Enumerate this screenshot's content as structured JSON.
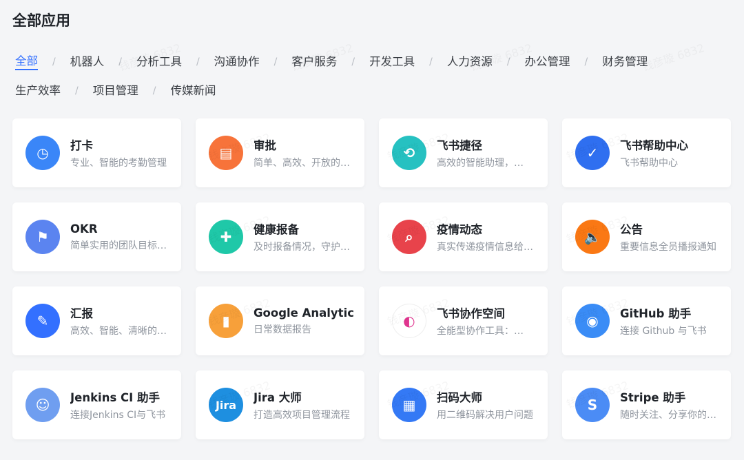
{
  "page_title": "全部应用",
  "watermark": "钱彦璇 6832",
  "tabs": [
    "全部",
    "机器人",
    "分析工具",
    "沟通协作",
    "客户服务",
    "开发工具",
    "人力资源",
    "办公管理",
    "财务管理",
    "生产效率",
    "项目管理",
    "传媒新闻"
  ],
  "separator": "/",
  "apps": [
    {
      "name": "打卡",
      "desc": "专业、智能的考勤管理",
      "icon": "location-clock-icon",
      "color": "#3a86f8",
      "glyph": "◷"
    },
    {
      "name": "审批",
      "desc": "简单、高效、开放的审批",
      "icon": "approval-stamp-icon",
      "color": "#f7733a",
      "glyph": "▤"
    },
    {
      "name": "飞书捷径",
      "desc": "高效的智能助理，…",
      "icon": "shortcut-path-icon",
      "color": "#26c1c1",
      "glyph": "⟲"
    },
    {
      "name": "飞书帮助中心",
      "desc": "飞书帮助中心",
      "icon": "help-check-icon",
      "color": "#2f6ff0",
      "glyph": "✓"
    },
    {
      "name": "OKR",
      "desc": "简单实用的团队目标管理",
      "icon": "flag-icon",
      "color": "#5b84f0",
      "glyph": "⚑"
    },
    {
      "name": "健康报备",
      "desc": "及时报备情况，守护健康",
      "icon": "health-clipboard-icon",
      "color": "#1fc8a8",
      "glyph": "✚"
    },
    {
      "name": "疫情动态",
      "desc": "真实传递疫情信息给大家",
      "icon": "virus-search-icon",
      "color": "#e8434b",
      "glyph": "⌕"
    },
    {
      "name": "公告",
      "desc": "重要信息全员播报通知",
      "icon": "speaker-icon",
      "color": "#fa7814",
      "glyph": "🔈"
    },
    {
      "name": "汇报",
      "desc": "高效、智能、清晰的汇报",
      "icon": "pencil-icon",
      "color": "#3370ff",
      "glyph": "✎"
    },
    {
      "name": "Google Analytics",
      "desc": "日常数据报告",
      "icon": "analytics-bars-icon",
      "color": "#f7a03a",
      "glyph": "▮"
    },
    {
      "name": "飞书协作空间",
      "desc": "全能型协作工具：…",
      "icon": "planet-icon",
      "color": "#ffffff",
      "glyph": "◐"
    },
    {
      "name": "GitHub 助手",
      "desc": "连接 Github 与飞书",
      "icon": "github-cat-icon",
      "color": "#3a8cf6",
      "glyph": "◉"
    },
    {
      "name": "Jenkins CI 助手",
      "desc": "连接Jenkins CI与飞书",
      "icon": "jenkins-butler-icon",
      "color": "#6f9ef0",
      "glyph": "☺"
    },
    {
      "name": "Jira 大师",
      "desc": "打造高效项目管理流程",
      "icon": "jira-logo-icon",
      "color": "#1e8fe0",
      "glyph": "Jira"
    },
    {
      "name": "扫码大师",
      "desc": "用二维码解决用户问题",
      "icon": "qr-code-icon",
      "color": "#3479f5",
      "glyph": "▦"
    },
    {
      "name": "Stripe 助手",
      "desc": "随时关注、分享你的收入",
      "icon": "stripe-card-icon",
      "color": "#4b8cf5",
      "glyph": "S"
    }
  ]
}
